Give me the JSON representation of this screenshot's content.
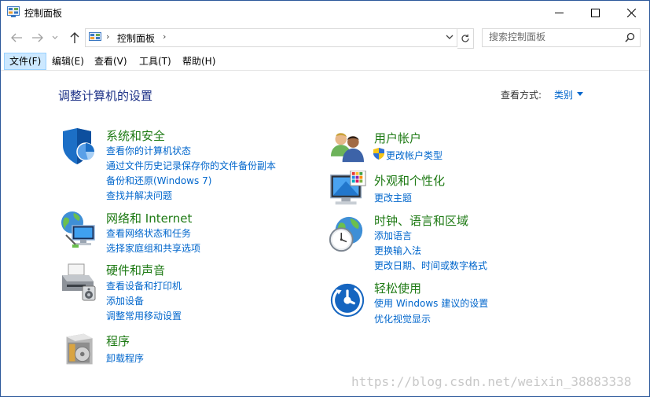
{
  "window": {
    "title": "控制面板"
  },
  "address": {
    "path": "控制面板"
  },
  "search": {
    "placeholder": "搜索控制面板"
  },
  "menu": [
    {
      "label": "文件(F)"
    },
    {
      "label": "编辑(E)"
    },
    {
      "label": "查看(V)"
    },
    {
      "label": "工具(T)"
    },
    {
      "label": "帮助(H)"
    }
  ],
  "main": {
    "heading": "调整计算机的设置",
    "view_by_label": "查看方式:",
    "view_by_value": "类别"
  },
  "categories": [
    {
      "title": "系统和安全",
      "icon": "shield-icon",
      "links": [
        "查看你的计算机状态",
        "通过文件历史记录保存你的文件备份副本",
        "备份和还原(Windows 7)",
        "查找并解决问题"
      ]
    },
    {
      "title": "网络和 Internet",
      "icon": "network-globe-icon",
      "links": [
        "查看网络状态和任务",
        "选择家庭组和共享选项"
      ]
    },
    {
      "title": "硬件和声音",
      "icon": "printer-icon",
      "links": [
        "查看设备和打印机",
        "添加设备",
        "调整常用移动设置"
      ]
    },
    {
      "title": "程序",
      "icon": "programs-icon",
      "links": [
        "卸载程序"
      ]
    },
    {
      "title": "用户帐户",
      "icon": "users-icon",
      "links": [
        "更改帐户类型"
      ]
    },
    {
      "title": "外观和个性化",
      "icon": "monitor-icon",
      "links": [
        "更改主题"
      ]
    },
    {
      "title": "时钟、语言和区域",
      "icon": "clock-globe-icon",
      "links": [
        "添加语言",
        "更换输入法",
        "更改日期、时间或数字格式"
      ]
    },
    {
      "title": "轻松使用",
      "icon": "accessibility-icon",
      "links": [
        "使用 Windows 建议的设置",
        "优化视觉显示"
      ]
    }
  ],
  "watermark": "https://blog.csdn.net/weixin_38883338"
}
